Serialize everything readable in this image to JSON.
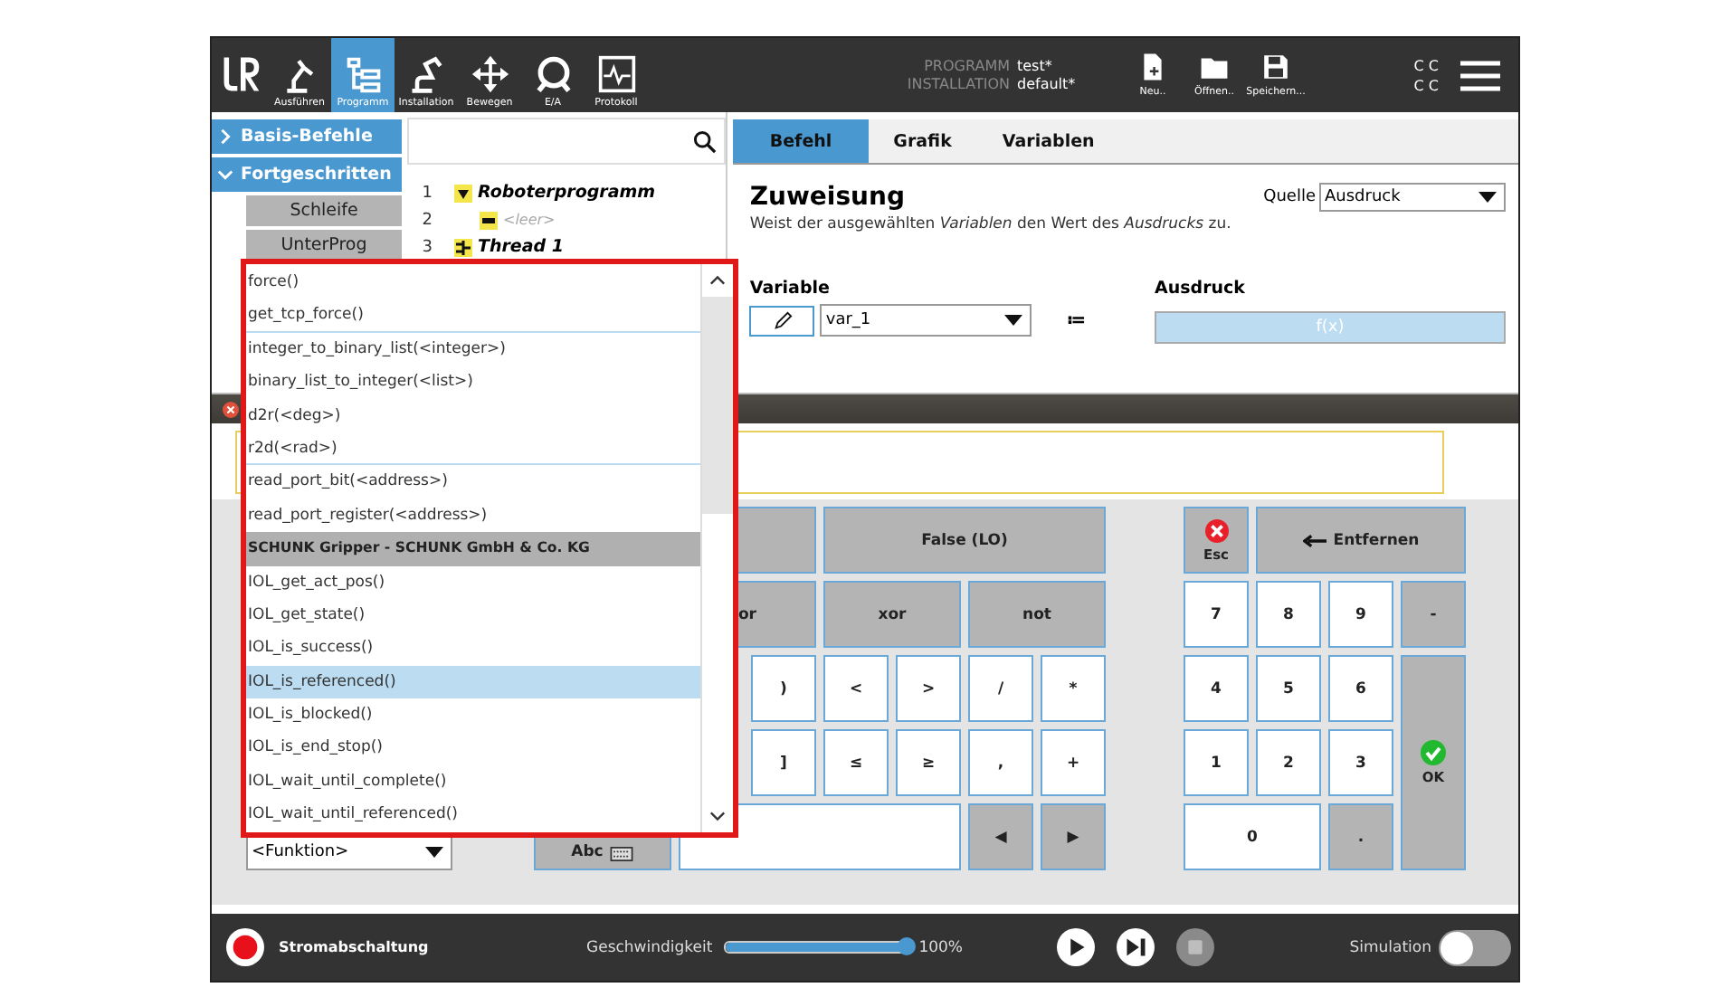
{
  "top_bar": {
    "nav": [
      {
        "label": "Ausführen",
        "selected": false
      },
      {
        "label": "Programm",
        "selected": true
      },
      {
        "label": "Installation",
        "selected": false
      },
      {
        "label": "Bewegen",
        "selected": false
      },
      {
        "label": "E/A",
        "selected": false
      },
      {
        "label": "Protokoll",
        "selected": false
      }
    ],
    "status": [
      {
        "label": "PROGRAMM",
        "value": "test*"
      },
      {
        "label": "INSTALLATION",
        "value": "default*"
      }
    ],
    "file_buttons": [
      {
        "label": "Neu.."
      },
      {
        "label": "Öffnen.."
      },
      {
        "label": "Speichern..."
      }
    ],
    "indicators": [
      "C C",
      "C C"
    ]
  },
  "categories": [
    {
      "label": "Basis-Befehle",
      "expanded": false
    },
    {
      "label": "Fortgeschritten",
      "expanded": true,
      "children": [
        {
          "label": "Schleife"
        },
        {
          "label": "UnterProg"
        }
      ]
    }
  ],
  "tree": [
    {
      "line": "1",
      "label": "Roboterprogramm",
      "kind": "program",
      "expanded": true,
      "children": [
        {
          "line": "2",
          "label": "<leer>",
          "kind": "empty"
        }
      ]
    },
    {
      "line": "3",
      "label": "Thread 1",
      "kind": "thread",
      "expanded": true
    }
  ],
  "tabs": [
    {
      "label": "Befehl",
      "selected": true
    },
    {
      "label": "Grafik",
      "selected": false
    },
    {
      "label": "Variablen",
      "selected": false
    }
  ],
  "command": {
    "title": "Zuweisung",
    "source_label": "Quelle",
    "source_value": "Ausdruck",
    "description": "Weist der ausgewählten *Variablen* den Wert des *Ausdrucks* zu.",
    "variable_label": "Variable",
    "variable_value": "var_1",
    "assign_symbol": "≔",
    "expression_label": "Ausdruck",
    "expression_button": "f(x)",
    "expression_disabled": true
  },
  "function_list": {
    "items": [
      {
        "label": "force()",
        "kind": "item",
        "selected": false,
        "separator_after": false
      },
      {
        "label": "get_tcp_force()",
        "kind": "item",
        "selected": false,
        "separator_after": true
      },
      {
        "label": "integer_to_binary_list(<integer>)",
        "kind": "item",
        "selected": false,
        "separator_after": false
      },
      {
        "label": "binary_list_to_integer(<list>)",
        "kind": "item",
        "selected": false,
        "separator_after": false
      },
      {
        "label": "d2r(<deg>)",
        "kind": "item",
        "selected": false,
        "separator_after": false
      },
      {
        "label": "r2d(<rad>)",
        "kind": "item",
        "selected": false,
        "separator_after": true
      },
      {
        "label": "read_port_bit(<address>)",
        "kind": "item",
        "selected": false,
        "separator_after": false
      },
      {
        "label": "read_port_register(<address>)",
        "kind": "item",
        "selected": false,
        "separator_after": false
      },
      {
        "label": "SCHUNK Gripper - SCHUNK GmbH & Co. KG",
        "kind": "header",
        "selected": false,
        "separator_after": false
      },
      {
        "label": "IOL_get_act_pos()",
        "kind": "item",
        "selected": false,
        "separator_after": false
      },
      {
        "label": "IOL_get_state()",
        "kind": "item",
        "selected": false,
        "separator_after": false
      },
      {
        "label": "IOL_is_success()",
        "kind": "item",
        "selected": false,
        "separator_after": false
      },
      {
        "label": "IOL_is_referenced()",
        "kind": "item",
        "selected": true,
        "separator_after": false
      },
      {
        "label": "IOL_is_blocked()",
        "kind": "item",
        "selected": false,
        "separator_after": false
      },
      {
        "label": "IOL_is_end_stop()",
        "kind": "item",
        "selected": false,
        "separator_after": false
      },
      {
        "label": "IOL_wait_until_complete()",
        "kind": "item",
        "selected": false,
        "separator_after": false
      },
      {
        "label": "IOL_wait_until_referenced()",
        "kind": "item",
        "selected": false,
        "separator_after": false
      }
    ]
  },
  "dialog": {
    "function_select": "<Funktion>",
    "keys": [
      {
        "label": "False (LO)",
        "kind": "function"
      },
      {
        "label": "or",
        "kind": "function"
      },
      {
        "label": "xor",
        "kind": "function"
      },
      {
        "label": "not",
        "kind": "function"
      },
      {
        "label": ")",
        "kind": "char"
      },
      {
        "label": "<",
        "kind": "char"
      },
      {
        "label": ">",
        "kind": "char"
      },
      {
        "label": "/",
        "kind": "char"
      },
      {
        "label": "*",
        "kind": "char"
      },
      {
        "label": "]",
        "kind": "char"
      },
      {
        "label": "≤",
        "kind": "char"
      },
      {
        "label": "≥",
        "kind": "char"
      },
      {
        "label": ",",
        "kind": "char"
      },
      {
        "label": "+",
        "kind": "char"
      },
      {
        "label": "Abc",
        "kind": "keyboard"
      },
      {
        "label": "◀",
        "kind": "function"
      },
      {
        "label": "▶",
        "kind": "function"
      }
    ],
    "numpad": [
      {
        "label": "Esc",
        "kind": "esc"
      },
      {
        "label": "Entfernen",
        "kind": "backspace"
      },
      {
        "label": "7",
        "kind": "char"
      },
      {
        "label": "8",
        "kind": "char"
      },
      {
        "label": "9",
        "kind": "char"
      },
      {
        "label": "-",
        "kind": "function"
      },
      {
        "label": "4",
        "kind": "char"
      },
      {
        "label": "5",
        "kind": "char"
      },
      {
        "label": "6",
        "kind": "char"
      },
      {
        "label": "OK",
        "kind": "ok"
      },
      {
        "label": "1",
        "kind": "char"
      },
      {
        "label": "2",
        "kind": "char"
      },
      {
        "label": "3",
        "kind": "char"
      },
      {
        "label": "0",
        "kind": "char"
      },
      {
        "label": ".",
        "kind": "function"
      }
    ]
  },
  "bottom_bar": {
    "power_label": "Stromabschaltung",
    "speed_label": "Geschwindigkeit",
    "speed": {
      "level": 1.0
    },
    "speed_reading": "100%",
    "controls": [
      {
        "kind": "play",
        "disabled": false
      },
      {
        "kind": "step",
        "disabled": false
      },
      {
        "kind": "stop",
        "disabled": true
      }
    ],
    "simulation_label": "Simulation",
    "simulation_on": false
  }
}
